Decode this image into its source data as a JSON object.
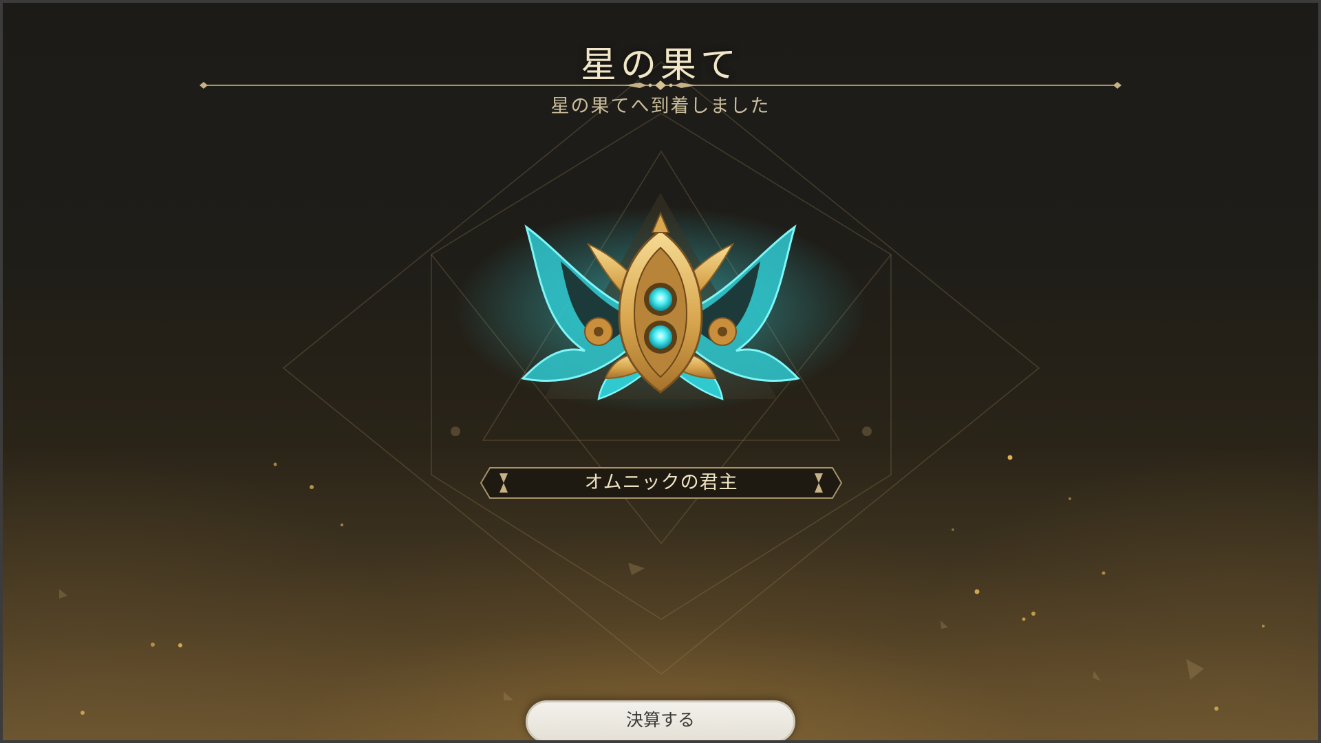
{
  "screen": {
    "title": "星の果て",
    "subtitle": "星の果てへ到着しました"
  },
  "reward": {
    "name": "オムニックの君主",
    "emblem_icon": "winged-gear-emblem-icon"
  },
  "actions": {
    "settle_label": "決算する"
  },
  "colors": {
    "gold_text": "#f2e6c8",
    "gold_line": "#a8936a",
    "emblem_gold": "#e8b95a",
    "emblem_cyan": "#3fe6ec",
    "button_bg": "#eeebe4"
  }
}
